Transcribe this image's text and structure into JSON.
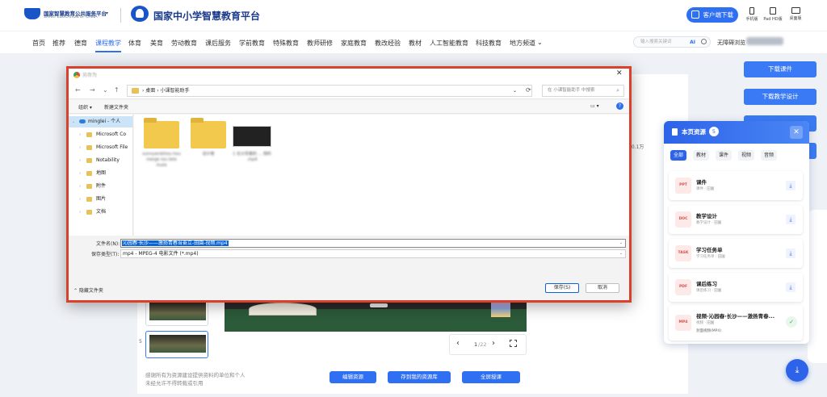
{
  "header": {
    "gov_platform_name": "国家智慧教育公共服务平台",
    "gov_platform_en": "SMART EDUCATION OF CHINA",
    "platform_title": "国家中小学智慧教育平台",
    "download_client": "客户端下载",
    "devices": [
      "手机版",
      "Pad HD版",
      "桌面版"
    ]
  },
  "nav": {
    "items": [
      "首页",
      "推荐",
      "德育",
      "课程教学",
      "体育",
      "美育",
      "劳动教育",
      "课后服务",
      "学前教育",
      "特殊教育",
      "教师研修",
      "家庭教育",
      "教改经验",
      "教材",
      "人工智能教育",
      "科技教育",
      "地方频道"
    ],
    "active": "课程教学",
    "more_caret": "⌄",
    "search_placeholder": "输入搜索关键词",
    "search_ai": "AI",
    "accessibility": "无障碍浏览"
  },
  "right_buttons": [
    "下载课件",
    "下载教学设计"
  ],
  "views_text": "10.1万",
  "lesson_numbers": [
    "5"
  ],
  "pager": {
    "current": "1",
    "total": "/22"
  },
  "disclaimer": [
    "感谢所有为资源建设提供资料的单位和个人",
    "未经允许不得转载或引用"
  ],
  "bottom_buttons": [
    "编辑资源",
    "存到我的资源库",
    "全屏授课"
  ],
  "resource_panel": {
    "title": "本页资源",
    "count": "5",
    "close": "✕",
    "tabs": [
      "全部",
      "教材",
      "课件",
      "视频",
      "音频"
    ],
    "items": [
      {
        "chip": "PPT",
        "title": "课件",
        "sub": "课件 · 田園"
      },
      {
        "chip": "DOC",
        "title": "教学设计",
        "sub": "教学设计 · 田園"
      },
      {
        "chip": "TASK",
        "title": "学习任务单",
        "sub": "学习任务单 · 田園"
      },
      {
        "chip": "PDF",
        "title": "课后练习",
        "sub": "课后练习 · 田園"
      },
      {
        "chip": "MP4",
        "title": "视频-沁园春·长沙——激扬青春...",
        "sub": "视频 · 田園",
        "status": "封面视频(MP4)"
      }
    ],
    "download_glyph": "⤓",
    "ok_glyph": "✓"
  },
  "dialog": {
    "title": "另存为",
    "close": "✕",
    "nav_glyphs": [
      "←",
      "→",
      "⌄",
      "↑"
    ],
    "breadcrumb": "›  桌面  ›  小课智能助手",
    "address_dropdown": "⌄",
    "refresh_glyph": "⟳",
    "search_placeholder": "在 小课智能助手 中搜索",
    "toolbar": {
      "organize": "组织 ▾",
      "new_folder": "新建文件夹",
      "view": "▭ ▾",
      "help": "?"
    },
    "tree": [
      {
        "label": "minglei - 个人",
        "kind": "cloud",
        "arrow": "⌄"
      },
      {
        "label": "Microsoft Co",
        "kind": "folder",
        "arrow": "›"
      },
      {
        "label": "Microsoft File",
        "kind": "folder",
        "arrow": "›"
      },
      {
        "label": "Notability",
        "kind": "folder",
        "arrow": "›"
      },
      {
        "label": "地图",
        "kind": "folder",
        "arrow": "›"
      },
      {
        "label": "附件",
        "kind": "folder",
        "arrow": "›"
      },
      {
        "label": "图片",
        "kind": "folder",
        "arrow": "›"
      },
      {
        "label": "文档",
        "kind": "folder",
        "arrow": "›"
      }
    ],
    "files": [
      {
        "name": "sunnyandshou hou merge rou tete mute",
        "kind": "folder"
      },
      {
        "name": "设计卷",
        "kind": "folder"
      },
      {
        "name": "1 长沙青春的 ... 用料 .mp4",
        "kind": "video"
      }
    ],
    "filename_label": "文件名(N):",
    "filename_value": "沁园春·长沙——激扬青春当奋立-田園-视频.mp4",
    "filetype_label": "保存类型(T):",
    "filetype_value": "mp4 - MPEG-4 电影文件 (*.mp4)",
    "hide_folders": "⌃ 隐藏文件夹",
    "save": "保存(S)",
    "cancel": "取消"
  }
}
